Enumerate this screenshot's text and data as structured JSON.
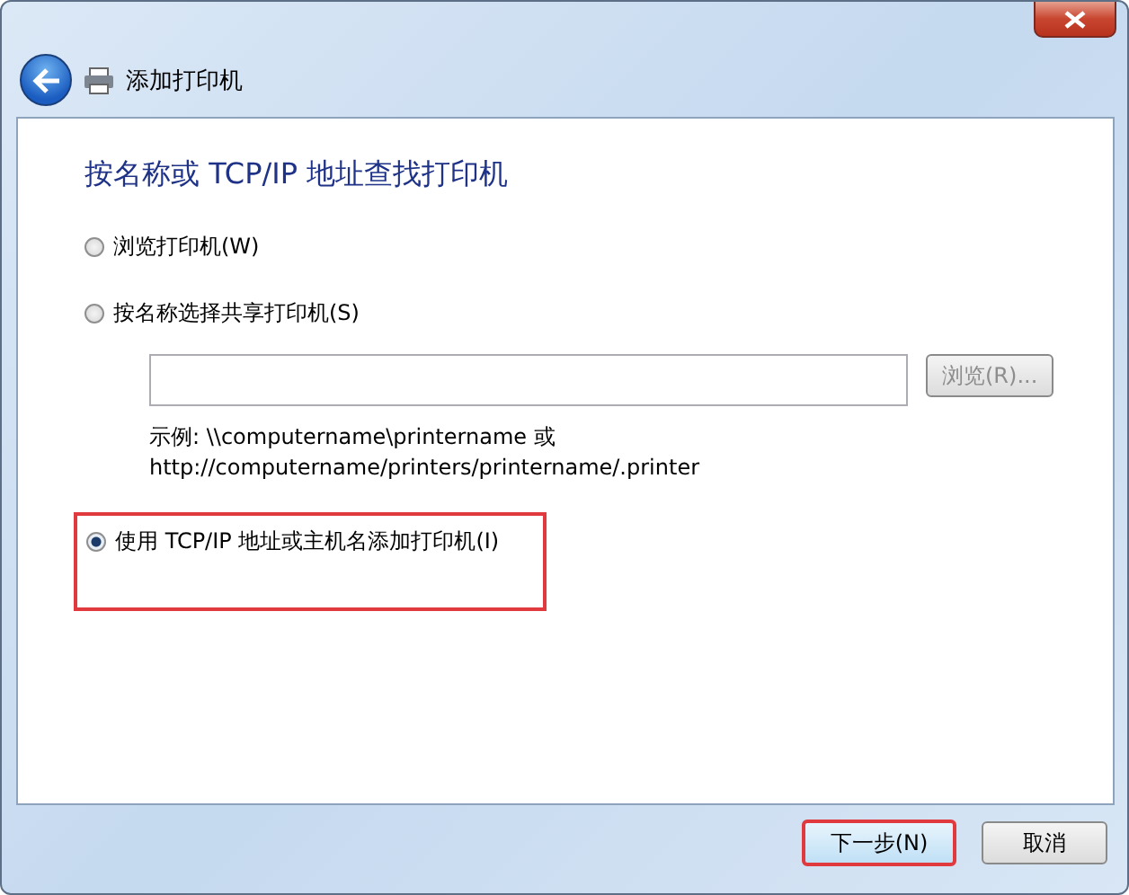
{
  "window": {
    "title": "添加打印机"
  },
  "heading": "按名称或 TCP/IP 地址查找打印机",
  "options": [
    {
      "label": "浏览打印机(W)",
      "selected": false,
      "highlighted": false
    },
    {
      "label": "按名称选择共享打印机(S)",
      "selected": false,
      "highlighted": false,
      "kind": "share"
    },
    {
      "label": "使用 TCP/IP 地址或主机名添加打印机(I)",
      "selected": true,
      "highlighted": true
    }
  ],
  "share": {
    "browse_button": {
      "label": "浏览(R)...",
      "disabled": true
    },
    "example_lines": [
      "示例: \\\\computername\\printername 或",
      "http://computername/printers/printername/.printer"
    ]
  },
  "buttons": [
    {
      "label": "下一步(N)",
      "highlighted": true
    },
    {
      "label": "取消",
      "highlighted": false
    }
  ]
}
